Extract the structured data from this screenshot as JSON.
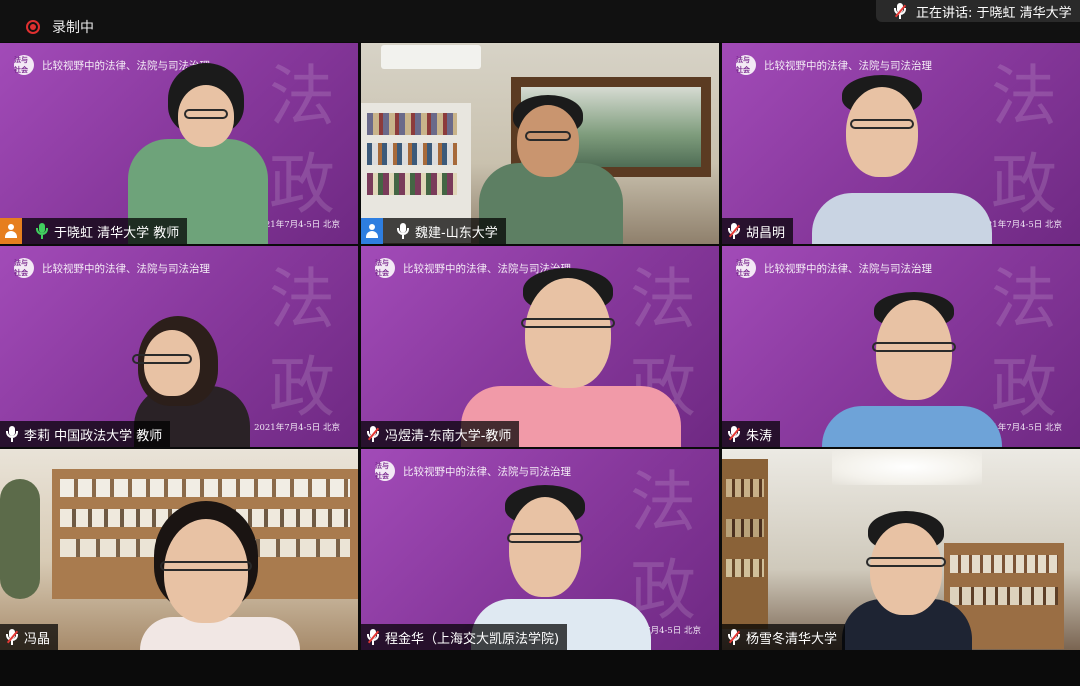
{
  "recording": {
    "label": "录制中"
  },
  "speaking": {
    "label": "正在讲话: 于晓虹 清华大学"
  },
  "slide": {
    "title": "比较视野中的法律、法院与司法治理",
    "date": "2021年7月4-5日 北京",
    "logo": "法与社会",
    "watermark": "法政"
  },
  "participants": [
    {
      "name": "于晓虹 清华大学 教师",
      "mic": "active",
      "avatar": "orange"
    },
    {
      "name": "魏建-山东大学",
      "mic": "on",
      "avatar": "blue"
    },
    {
      "name": "胡昌明",
      "mic": "muted"
    },
    {
      "name": "李莉 中国政法大学 教师",
      "mic": "on"
    },
    {
      "name": "冯煜清-东南大学-教师",
      "mic": "muted"
    },
    {
      "name": "朱涛",
      "mic": "muted"
    },
    {
      "name": "冯晶",
      "mic": "muted"
    },
    {
      "name": "程金华（上海交大凯原法学院)",
      "mic": "muted"
    },
    {
      "name": "杨雪冬清华大学",
      "mic": "muted"
    }
  ],
  "colors": {
    "accent_red": "#e03030",
    "speaking_green": "#41d05f",
    "slide_purple": "#8a3a9f"
  }
}
